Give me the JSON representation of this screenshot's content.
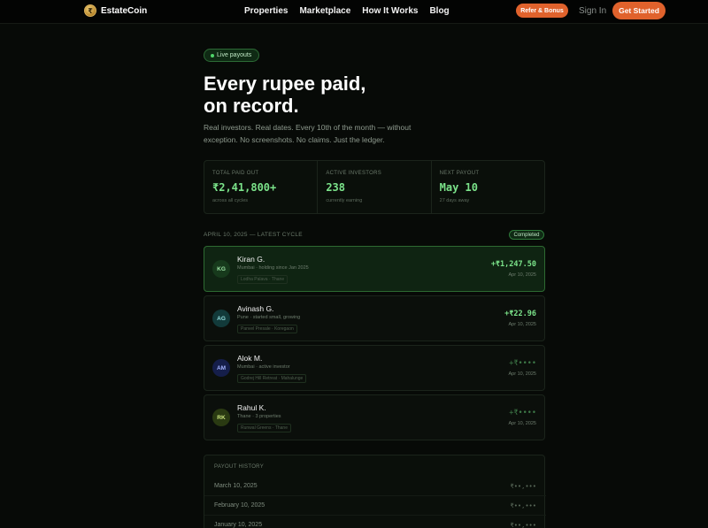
{
  "nav": {
    "logo_glyph": "₹",
    "brand": "EstateCoin",
    "links": [
      "Properties",
      "Marketplace",
      "How It Works",
      "Blog"
    ],
    "refer_label": "Refer & Bonus",
    "signin_label": "Sign In",
    "cta_label": "Get Started"
  },
  "hero": {
    "pill": "Live payouts",
    "title_line1": "Every rupee paid,",
    "title_line2": "on record.",
    "subtitle": "Real investors. Real dates. Every 10th of the month — without exception. No screenshots. No claims. Just the ledger."
  },
  "stats": [
    {
      "label": "TOTAL PAID OUT",
      "value": "₹2,41,800+",
      "note": "across all cycles"
    },
    {
      "label": "ACTIVE INVESTORS",
      "value": "238",
      "note": "currently earning"
    },
    {
      "label": "NEXT PAYOUT",
      "value": "May 10",
      "note": "27 days away"
    }
  ],
  "cycle": {
    "label": "APRIL 10, 2025 — LATEST CYCLE",
    "status": "Completed"
  },
  "payouts": [
    {
      "initials": "KG",
      "name": "Kiran G.",
      "meta": "Mumbai · holding since Jan 2025",
      "tag": "Lodha Palava · Thane",
      "amount": "+₹1,247.50",
      "date": "Apr 10, 2025"
    },
    {
      "initials": "AG",
      "name": "Avinash G.",
      "meta": "Pune · started small, growing",
      "tag": "Panvel Presale · Koregaon",
      "amount": "+₹22.96",
      "date": "Apr 10, 2025"
    },
    {
      "initials": "AM",
      "name": "Alok M.",
      "meta": "Mumbai · active investor",
      "tag": "Godrej Hill Retreat · Mahalunge",
      "amount": "+₹••••",
      "date": "Apr 10, 2025"
    },
    {
      "initials": "RK",
      "name": "Rahul K.",
      "meta": "Thane · 3 properties",
      "tag": "Runwal Greens · Thane",
      "amount": "+₹••••",
      "date": "Apr 10, 2025"
    }
  ],
  "history": {
    "title": "PAYOUT HISTORY",
    "rows": [
      {
        "date": "March 10, 2025",
        "amount": "₹••,•••"
      },
      {
        "date": "February 10, 2025",
        "amount": "₹••,•••"
      },
      {
        "date": "January 10, 2025",
        "amount": "₹••,•••"
      }
    ]
  },
  "colors": {
    "accent": "#e0622c",
    "money_green": "#7be38a",
    "background": "#070a07"
  }
}
